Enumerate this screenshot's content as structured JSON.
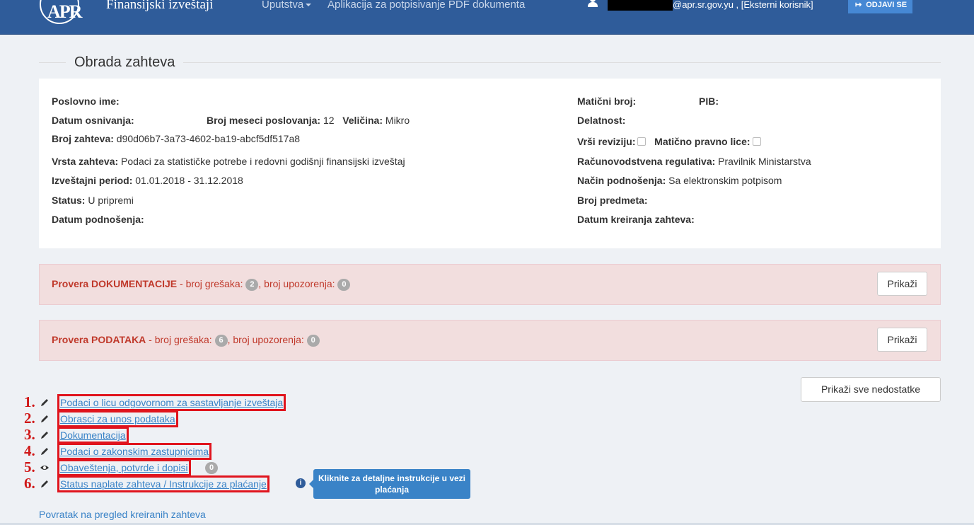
{
  "navbar": {
    "logo_text": "APR",
    "brand": "Finansijski izveštaji",
    "uputstva": "Uputstva",
    "app_link": "Aplikacija za potpisivanje PDF dokumenta",
    "user_text": "@apr.sr.gov.yu , [Eksterni korisnik]",
    "logout": "ODJAVI SE"
  },
  "page": {
    "title": "Obrada zahteva"
  },
  "info": {
    "poslovno_ime_label": "Poslovno ime:",
    "datum_osnivanja_label": "Datum osnivanja:",
    "broj_meseci_label": "Broj meseci poslovanja:",
    "broj_meseci_value": " 12",
    "velicina_label": "Veličina:",
    "velicina_value": " Mikro",
    "broj_zahteva_label": "Broj zahteva:",
    "broj_zahteva_value": " d90d06b7-3a73-4602-ba19-abcf5df517a8",
    "vrsta_zahteva_label": "Vrsta zahteva:",
    "vrsta_zahteva_value": " Podaci za statističke potrebe i redovni godišnji finansijski izveštaj",
    "izvestajni_period_label": "Izveštajni period:",
    "izvestajni_period_value": " 01.01.2018 - 31.12.2018",
    "status_label": "Status:",
    "status_value": " U pripremi",
    "datum_podnosenja_label": "Datum podnošenja:",
    "maticni_broj_label": "Matični broj:",
    "pib_label": "PIB:",
    "delatnost_label": "Delatnost:",
    "vrsi_reviziju_label": "Vrši reviziju:",
    "maticno_pravno_lice_label": "Matično pravno lice:",
    "racunovodstvena_label": "Računovodstvena regulativa:",
    "racunovodstvena_value": " Pravilnik Ministarstva",
    "nacin_label": "Način podnošenja:",
    "nacin_value": " Sa elektronskim potpisom",
    "broj_predmeta_label": "Broj predmeta:",
    "datum_kreiranja_label": "Datum kreiranja zahteva:"
  },
  "alerts": [
    {
      "bold": "Provera DOKUMENTACIJE",
      "mid": " - broj grešaka: ",
      "errors": "2",
      "warn_label": ", broj upozorenja: ",
      "warnings": "0",
      "button": "Prikaži"
    },
    {
      "bold": "Provera PODATAKA",
      "mid": " - broj grešaka: ",
      "errors": "6",
      "warn_label": ", broj upozorenja: ",
      "warnings": "0",
      "button": "Prikaži"
    }
  ],
  "show_all_button": "Prikaži sve nedostatke",
  "links": [
    {
      "num": "1.",
      "label": "Podaci o licu odgovornom za sastavljanje izveštaja"
    },
    {
      "num": "2.",
      "label": "Obrasci za unos podataka"
    },
    {
      "num": "3.",
      "label": "Dokumentacija"
    },
    {
      "num": "4.",
      "label": "Podaci o zakonskim zastupnicima"
    },
    {
      "num": "5.",
      "label": "Obaveštenja, potvrde i dopisi",
      "badge": "0"
    },
    {
      "num": "6.",
      "label": "Status naplate zahteva / Instrukcije za plaćanje"
    }
  ],
  "tooltip": "Kliknite za detaljne instrukcije u vezi plaćanja",
  "back_link": "Povratak na pregled kreiranih zahteva",
  "colors": {
    "navbar": "#2f5c9a",
    "link": "#3a83c7",
    "alert_text": "#c0392b",
    "annotation_red": "#e0141d"
  }
}
